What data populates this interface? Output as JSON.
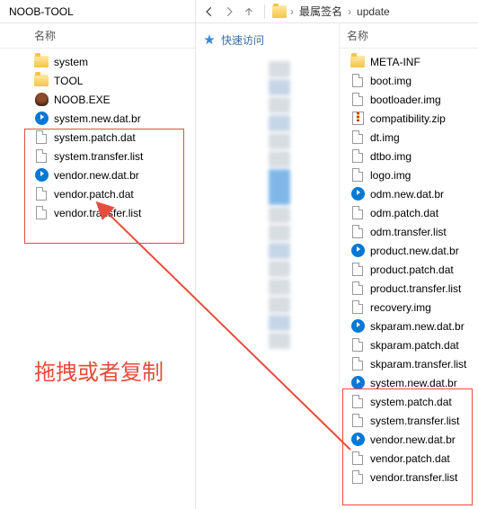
{
  "left": {
    "title": "NOOB-TOOL",
    "header": "名称",
    "items": [
      {
        "icon": "folder",
        "name": "system"
      },
      {
        "icon": "folder",
        "name": "TOOL"
      },
      {
        "icon": "exe",
        "name": "NOOB.EXE"
      },
      {
        "icon": "br",
        "name": "system.new.dat.br"
      },
      {
        "icon": "file",
        "name": "system.patch.dat"
      },
      {
        "icon": "file",
        "name": "system.transfer.list"
      },
      {
        "icon": "br",
        "name": "vendor.new.dat.br"
      },
      {
        "icon": "file",
        "name": "vendor.patch.dat"
      },
      {
        "icon": "file",
        "name": "vendor.transfer.list"
      }
    ]
  },
  "right": {
    "breadcrumb": [
      "最属签名",
      "update"
    ],
    "quick_access": "快速访问",
    "header": "名称",
    "items": [
      {
        "icon": "folder",
        "name": "META-INF"
      },
      {
        "icon": "file",
        "name": "boot.img"
      },
      {
        "icon": "file",
        "name": "bootloader.img"
      },
      {
        "icon": "zip",
        "name": "compatibility.zip"
      },
      {
        "icon": "file",
        "name": "dt.img"
      },
      {
        "icon": "file",
        "name": "dtbo.img"
      },
      {
        "icon": "file",
        "name": "logo.img"
      },
      {
        "icon": "br",
        "name": "odm.new.dat.br"
      },
      {
        "icon": "file",
        "name": "odm.patch.dat"
      },
      {
        "icon": "file",
        "name": "odm.transfer.list"
      },
      {
        "icon": "br",
        "name": "product.new.dat.br"
      },
      {
        "icon": "file",
        "name": "product.patch.dat"
      },
      {
        "icon": "file",
        "name": "product.transfer.list"
      },
      {
        "icon": "file",
        "name": "recovery.img"
      },
      {
        "icon": "br",
        "name": "skparam.new.dat.br"
      },
      {
        "icon": "file",
        "name": "skparam.patch.dat"
      },
      {
        "icon": "file",
        "name": "skparam.transfer.list"
      },
      {
        "icon": "br",
        "name": "system.new.dat.br"
      },
      {
        "icon": "file",
        "name": "system.patch.dat"
      },
      {
        "icon": "file",
        "name": "system.transfer.list"
      },
      {
        "icon": "br",
        "name": "vendor.new.dat.br"
      },
      {
        "icon": "file",
        "name": "vendor.patch.dat"
      },
      {
        "icon": "file",
        "name": "vendor.transfer.list"
      }
    ]
  },
  "drag_label": "拖拽或者复制",
  "annotation_color": "#e74c3c"
}
